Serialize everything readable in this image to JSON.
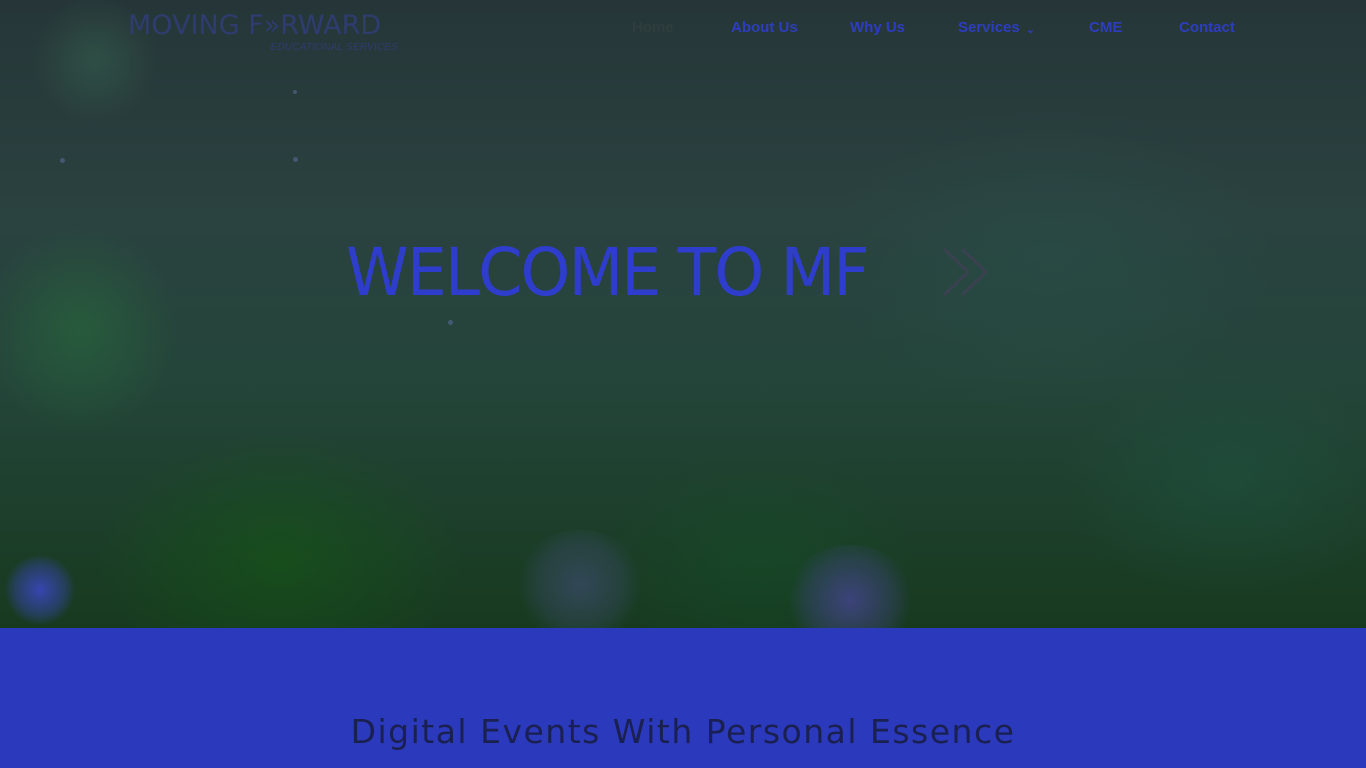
{
  "brand": {
    "logo_main": "MOVING F»RWARD",
    "logo_sub": "EDUCATIONAL SERVICES"
  },
  "nav": {
    "items": [
      {
        "label": "Home",
        "active": true
      },
      {
        "label": "About Us",
        "active": false
      },
      {
        "label": "Why Us",
        "active": false
      },
      {
        "label": "Services",
        "active": false,
        "has_dropdown": true
      },
      {
        "label": "CME",
        "active": false
      },
      {
        "label": "Contact",
        "active": false
      }
    ],
    "dropdown_icon": "chevron-down-icon"
  },
  "hero": {
    "headline": "WELCOME TO MF",
    "headline_icon": "double-chevron-right-icon"
  },
  "band": {
    "tagline": "Digital Events With Personal Essence"
  },
  "colors": {
    "accent_blue": "#2d3dc0",
    "band_blue": "#2b39bd",
    "active_nav": "#2f3d3e",
    "hero_dark": "#263638",
    "tagline_text": "#1a2050"
  }
}
